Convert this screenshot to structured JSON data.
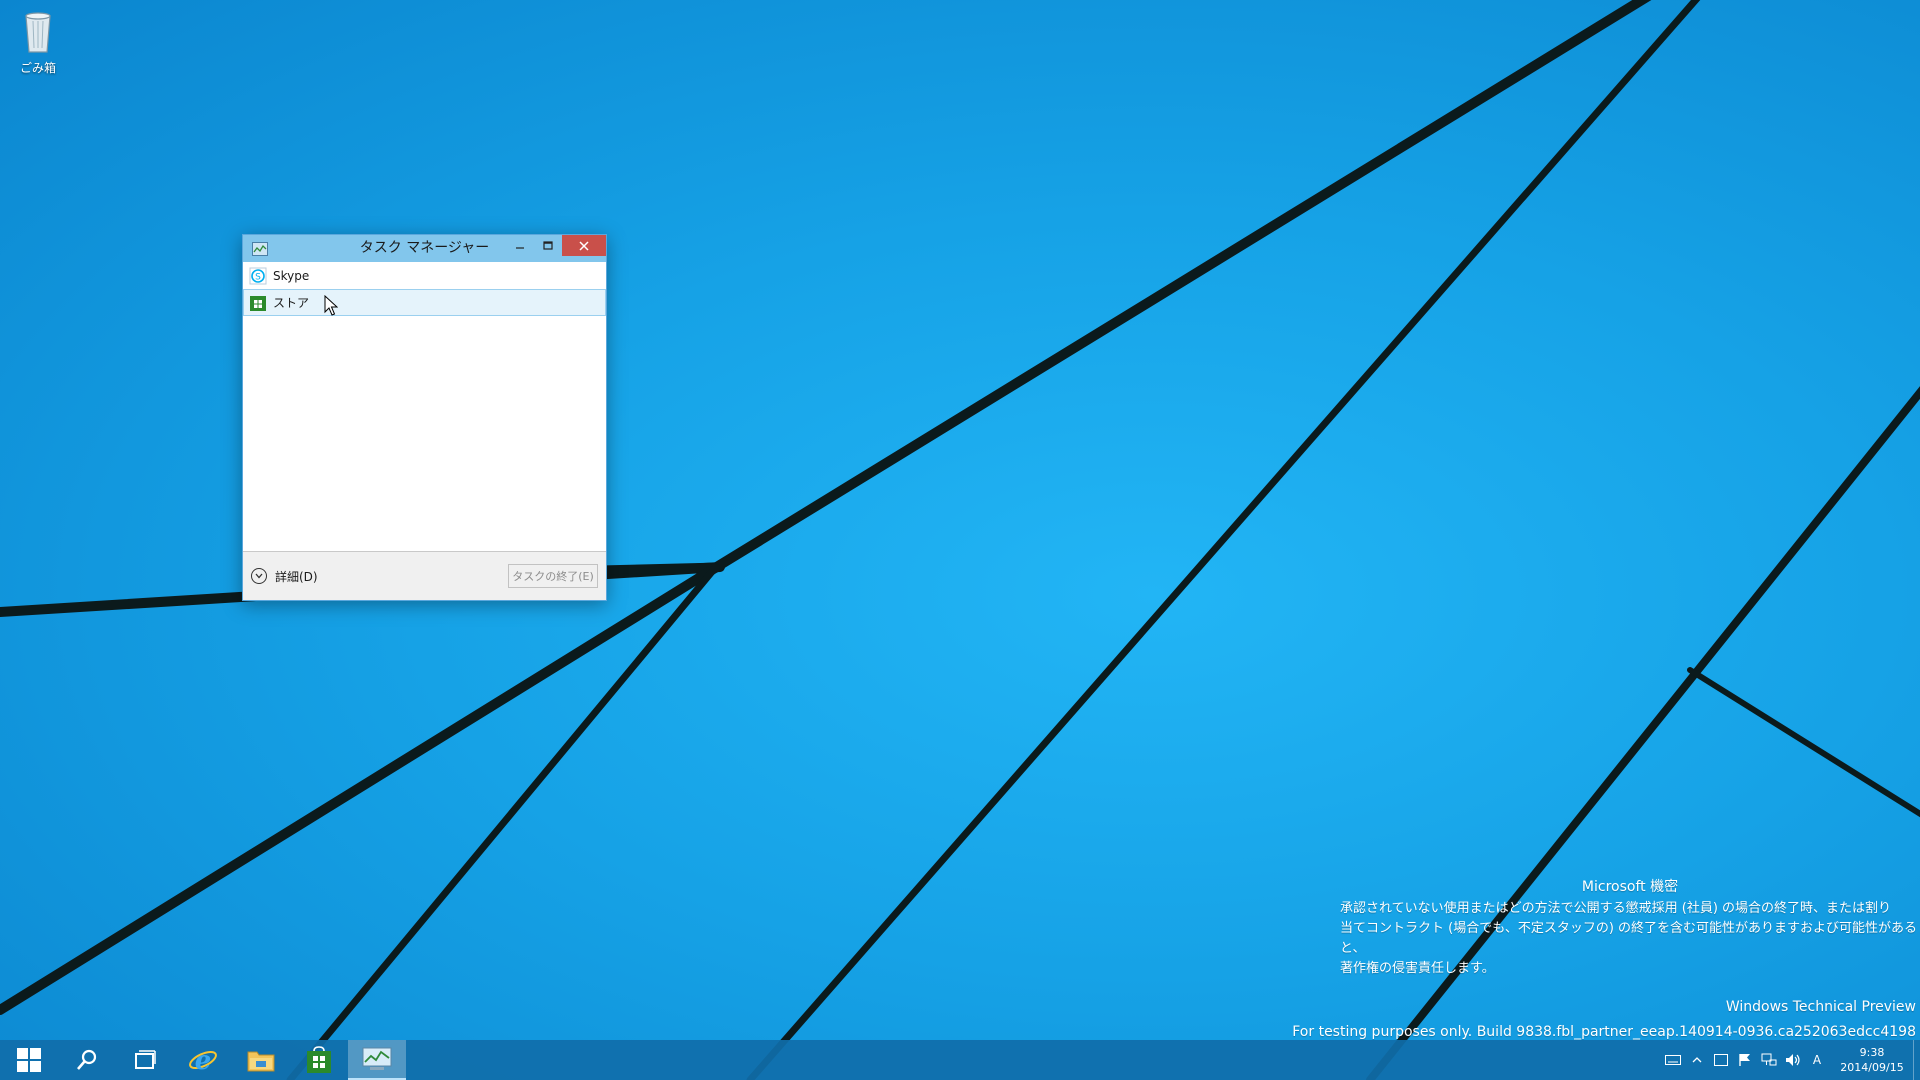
{
  "desktop": {
    "icons": [
      {
        "label": "ごみ箱",
        "icon": "recycle-bin-icon"
      }
    ]
  },
  "task_manager": {
    "title": "タスク マネージャー",
    "apps": [
      {
        "name": "Skype",
        "icon": "skype-icon",
        "selected": false
      },
      {
        "name": "ストア",
        "icon": "store-icon",
        "selected": true
      }
    ],
    "more_details_label": "詳細(D)",
    "end_task_label": "タスクの終了(E)"
  },
  "watermark": {
    "confidential_title": "Microsoft 機密",
    "confidential_lines": [
      "承認されていない使用またはどの方法で公開する懲戒採用 (社員) の場合の終了時、または割り",
      "当てコントラクト (場合でも、不定スタッフの) の終了を含む可能性がありますおよび可能性があると、",
      "著作権の侵害責任します。"
    ],
    "edition": "Windows Technical Preview",
    "build": "For testing purposes only. Build 9838.fbl_partner_eeap.140914-0936.ca252063edcc4198"
  },
  "taskbar": {
    "items": [
      {
        "name": "start-button",
        "icon": "windows-logo-icon"
      },
      {
        "name": "search-button",
        "icon": "search-icon"
      },
      {
        "name": "task-view-button",
        "icon": "task-view-icon"
      },
      {
        "name": "internet-explorer-button",
        "icon": "ie-icon"
      },
      {
        "name": "file-explorer-button",
        "icon": "folder-icon"
      },
      {
        "name": "store-button",
        "icon": "store-icon"
      },
      {
        "name": "task-manager-button",
        "icon": "task-manager-icon",
        "active": true
      }
    ],
    "tray": {
      "ime_label": "A",
      "time": "9:38",
      "date": "2014/09/15"
    }
  },
  "colors": {
    "titlebar": "#82c6ec",
    "close_button": "#c9504a",
    "selection": "#e5f3fb",
    "taskbar": "#106eaa"
  }
}
